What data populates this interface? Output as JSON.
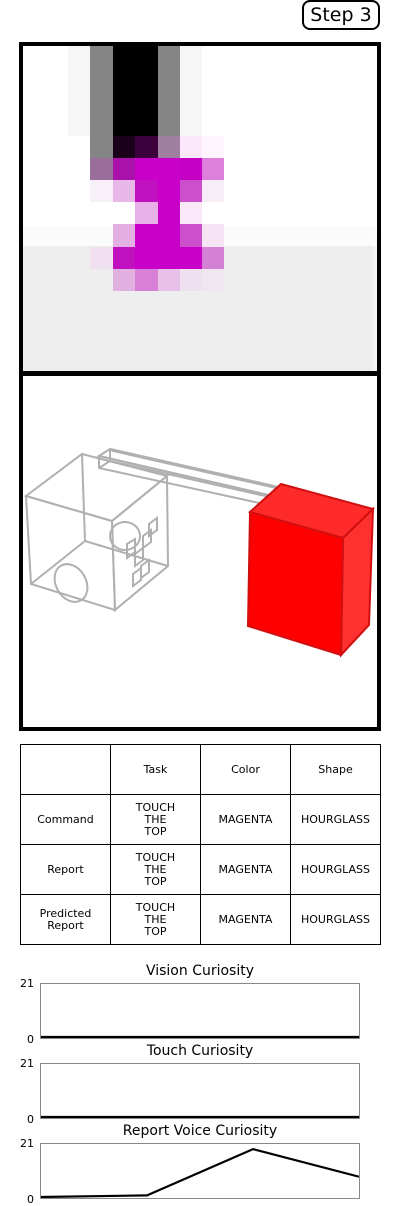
{
  "step_badge": "Step 3",
  "table": {
    "headers": [
      "",
      "Task",
      "Color",
      "Shape"
    ],
    "rows": [
      {
        "label": "Command",
        "task": "TOUCH\nTHE\nTOP",
        "color": "MAGENTA",
        "shape": "HOURGLASS"
      },
      {
        "label": "Report",
        "task": "TOUCH\nTHE\nTOP",
        "color": "MAGENTA",
        "shape": "HOURGLASS"
      },
      {
        "label": "Predicted\nReport",
        "task": "TOUCH\nTHE\nTOP",
        "color": "MAGENTA",
        "shape": "HOURGLASS"
      }
    ]
  },
  "plots": [
    {
      "title": "Vision Curiosity",
      "y_max": "21",
      "y_min": "0",
      "values": [
        0,
        0,
        0,
        0
      ]
    },
    {
      "title": "Touch Curiosity",
      "y_max": "21",
      "y_min": "0",
      "values": [
        0,
        0,
        0,
        0
      ]
    },
    {
      "title": "Report Voice Curiosity",
      "y_max": "21",
      "y_min": "0",
      "values": [
        0,
        1,
        19,
        8.3
      ]
    }
  ],
  "colors": {
    "object": "#ff0000",
    "magenta": "#c800c8"
  }
}
